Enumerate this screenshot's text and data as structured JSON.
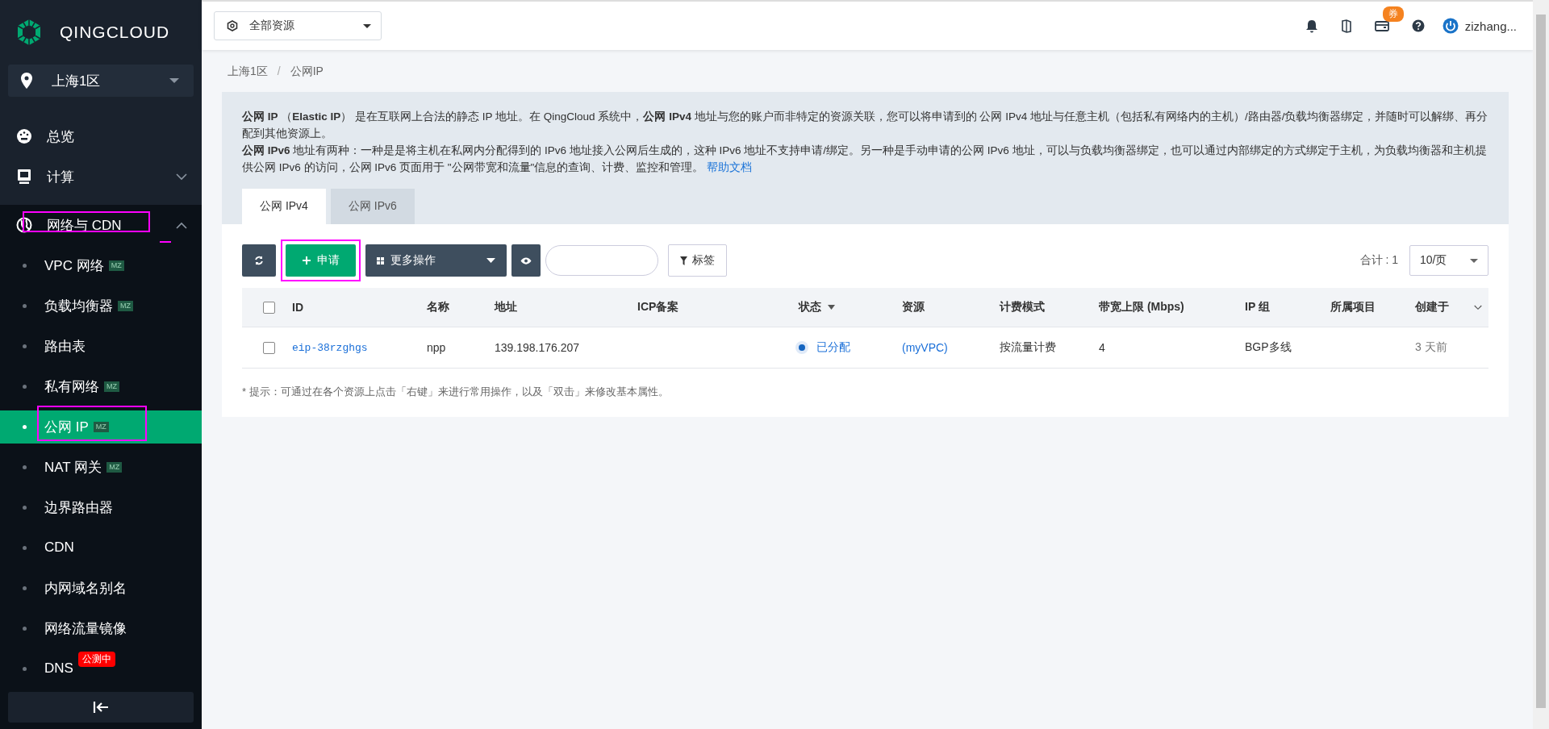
{
  "sidebar": {
    "logo": "QINGCLOUD",
    "region": "上海1区",
    "items": [
      {
        "kind": "link",
        "label": "总览"
      },
      {
        "kind": "group",
        "label": "计算",
        "expanded": false,
        "highlighted": false
      },
      {
        "kind": "group",
        "label": "网络与 CDN",
        "expanded": true,
        "highlighted": true,
        "children": [
          {
            "label": "VPC 网络",
            "badge": "MZ",
            "selected": false,
            "highlighted": false
          },
          {
            "label": "负载均衡器",
            "badge": "MZ",
            "selected": false,
            "highlighted": false
          },
          {
            "label": "路由表",
            "selected": false,
            "highlighted": false
          },
          {
            "label": "私有网络",
            "badge": "MZ",
            "selected": false,
            "highlighted": false
          },
          {
            "label": "公网 IP",
            "badge": "MZ",
            "selected": true,
            "highlighted": true
          },
          {
            "label": "NAT 网关",
            "badge": "MZ",
            "selected": false,
            "highlighted": false
          },
          {
            "label": "边界路由器",
            "selected": false,
            "highlighted": false
          },
          {
            "label": "CDN",
            "selected": false,
            "highlighted": false
          },
          {
            "label": "内网域名别名",
            "selected": false,
            "highlighted": false
          },
          {
            "label": "网络流量镜像",
            "selected": false,
            "highlighted": false
          },
          {
            "label": "DNS",
            "tag": "公测中",
            "selected": false,
            "highlighted": false
          }
        ]
      }
    ]
  },
  "topbar": {
    "scope": "全部资源",
    "coupon": "券",
    "user": "zizhang..."
  },
  "breadcrumb": {
    "items": [
      "上海1区",
      "公网IP"
    ],
    "separator": "/"
  },
  "info": {
    "paragraphs": [
      "**公网 IP** （**Elastic IP**） 是在互联网上合法的静态 IP 地址。在 QingCloud 系统中，**公网 IPv4** 地址与您的账户而非特定的资源关联，您可以将申请到的 公网 IPv4 地址与任意主机（包括私有网络内的主机）/路由器/负载均衡器绑定，并随时可以解绑、再分配到其他资源上。",
      "**公网 IPv6** 地址有两种：一种是是将主机在私网内分配得到的 IPv6 地址接入公网后生成的，这种 IPv6 地址不支持申请/绑定。另一种是手动申请的公网 IPv6 地址，可以与负载均衡器绑定，也可以通过内部绑定的方式绑定于主机，为负载均衡器和主机提供公网 IPv6 的访问，公网 IPv6 页面用于 \"公网带宽和流量\"信息的查询、计费、监控和管理。"
    ],
    "help_link": "帮助文档"
  },
  "tabs": [
    {
      "label": "公网 IPv4",
      "selected": true
    },
    {
      "label": "公网 IPv6",
      "selected": false
    }
  ],
  "toolbar": {
    "apply": {
      "label": "申请",
      "highlighted": true
    },
    "more_actions": "更多操作",
    "tag_button": "标签",
    "total": "合计 : 1",
    "page_size": "10/页"
  },
  "table": {
    "select_all_checked": false,
    "columns": [
      {
        "kind": "code",
        "label": "ID"
      },
      {
        "kind": "text",
        "label": "名称"
      },
      {
        "kind": "text",
        "label": "地址"
      },
      {
        "kind": "text",
        "label": "ICP备案"
      },
      {
        "kind": "status",
        "label": "状态",
        "sortable": true
      },
      {
        "kind": "link",
        "label": "资源"
      },
      {
        "kind": "text",
        "label": "计费模式"
      },
      {
        "kind": "text",
        "label": "带宽上限 (Mbps)"
      },
      {
        "kind": "text",
        "label": "IP 组"
      },
      {
        "kind": "text",
        "label": "所属项目"
      },
      {
        "kind": "muted",
        "label": "创建于"
      }
    ],
    "rows": [
      {
        "checked": false,
        "cells": [
          "eip-38rzghgs",
          "npp",
          "139.198.176.207",
          null,
          {
            "text": "已分配",
            "color": "#1565c0"
          },
          "(myVPC)",
          "按流量计费",
          "4",
          "BGP多线",
          null,
          "3 天前"
        ]
      }
    ]
  },
  "hint": "* 提示：可通过在各个资源上点击「右键」来进行常用操作，以及「双击」来修改基本属性。"
}
